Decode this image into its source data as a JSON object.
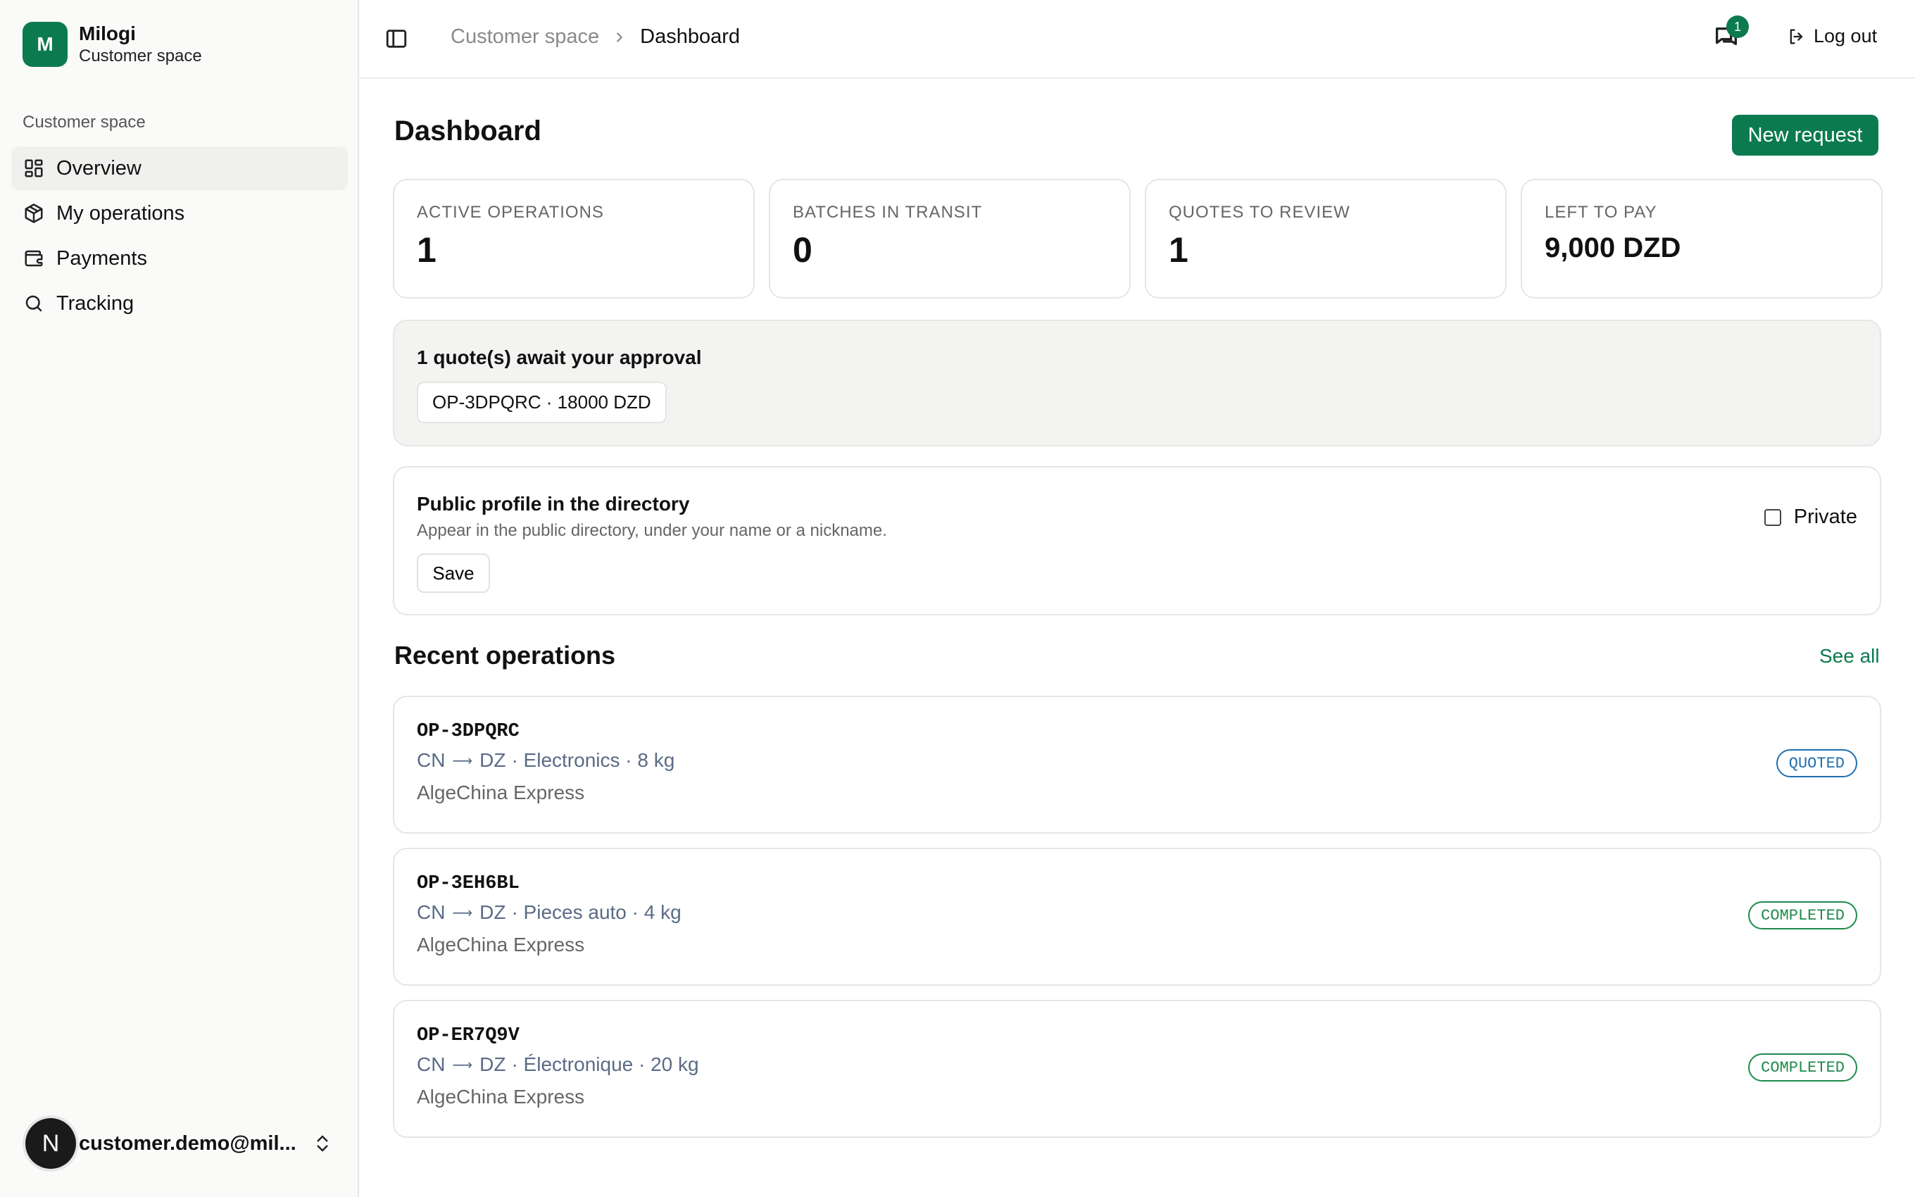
{
  "brand": {
    "logo_letter": "M",
    "name": "Milogi",
    "subtitle": "Customer space"
  },
  "sidebar": {
    "group_label": "Customer space",
    "items": [
      {
        "label": "Overview",
        "icon": "grid-icon",
        "active": true
      },
      {
        "label": "My operations",
        "icon": "package-icon",
        "active": false
      },
      {
        "label": "Payments",
        "icon": "wallet-icon",
        "active": false
      },
      {
        "label": "Tracking",
        "icon": "search-icon",
        "active": false
      }
    ]
  },
  "user": {
    "avatar_letter": "N",
    "email": "customer.demo@mil..."
  },
  "header": {
    "breadcrumb": [
      "Customer space",
      "Dashboard"
    ],
    "notifications_count": "1",
    "logout_label": "Log out"
  },
  "main": {
    "title": "Dashboard",
    "new_request_label": "New request",
    "stats": [
      {
        "label": "ACTIVE OPERATIONS",
        "value": "1"
      },
      {
        "label": "BATCHES IN TRANSIT",
        "value": "0"
      },
      {
        "label": "QUOTES TO REVIEW",
        "value": "1"
      },
      {
        "label": "LEFT TO PAY",
        "value": "9,000 DZD"
      }
    ],
    "quotes": {
      "title": "1 quote(s) await your approval",
      "chip": "OP-3DPQRC · 18000 DZD"
    },
    "profile": {
      "title": "Public profile in the directory",
      "description": "Appear in the public directory, under your name or a nickname.",
      "save_label": "Save",
      "private_label": "Private"
    },
    "recent": {
      "title": "Recent operations",
      "see_all_label": "See all",
      "operations": [
        {
          "id": "OP-3DPQRC",
          "from": "CN",
          "arrow": "⟶",
          "to": "DZ",
          "details": "· Electronics · 8 kg",
          "carrier": "AlgeChina Express",
          "status": "QUOTED"
        },
        {
          "id": "OP-3EH6BL",
          "from": "CN",
          "arrow": "⟶",
          "to": "DZ",
          "details": "· Pieces auto · 4 kg",
          "carrier": "AlgeChina Express",
          "status": "COMPLETED"
        },
        {
          "id": "OP-ER7Q9V",
          "from": "CN",
          "arrow": "⟶",
          "to": "DZ",
          "details": "· Électronique · 20 kg",
          "carrier": "AlgeChina Express",
          "status": "COMPLETED"
        }
      ]
    }
  },
  "colors": {
    "accent": "#0b7a4f",
    "quoted": "#1f6fb0",
    "completed": "#1f8a4c"
  }
}
